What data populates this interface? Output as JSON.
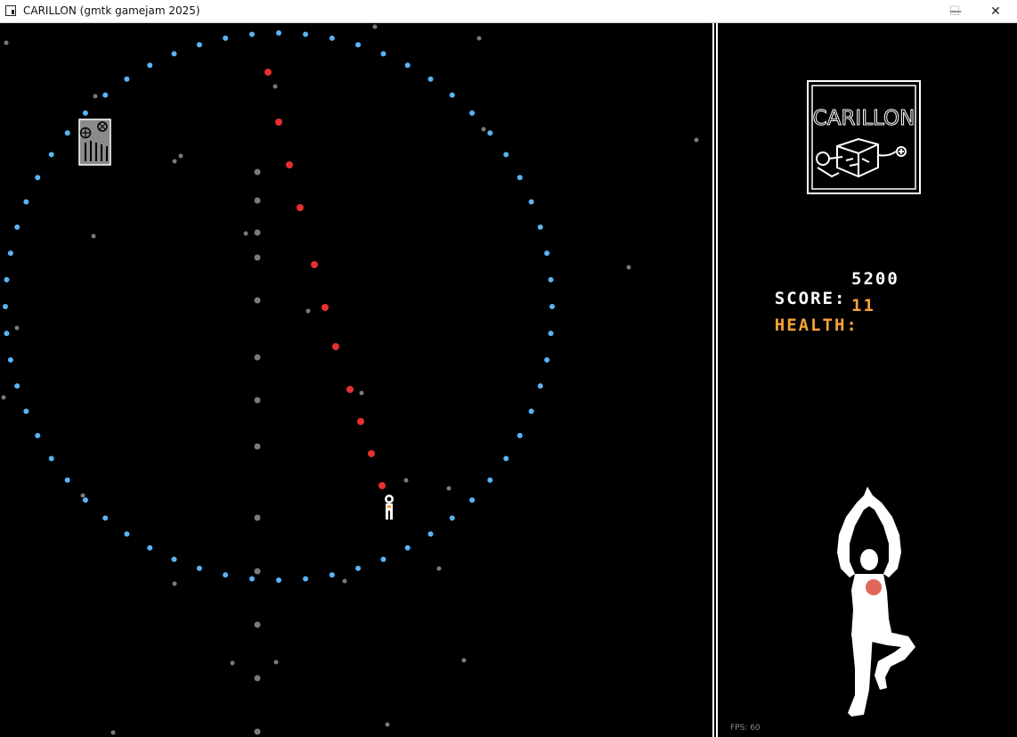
{
  "window": {
    "title": "CARILLON (gmtk gamejam 2025)",
    "minimize_glyph": "—",
    "maximize_glyph": "☐",
    "close_glyph": "✕"
  },
  "hud": {
    "score_label": "SCORE:",
    "score_value": "5200",
    "health_label": "HEALTH:",
    "health_value": "11",
    "fps": "FPS: 60",
    "logo_text": "CARILLON"
  },
  "colors": {
    "orbit_dot": "#5ab4f5",
    "path_dot": "#e53030",
    "star_dot": "#7a7a7a",
    "health": "#f7a238",
    "heart": "#e0685a"
  },
  "sprites": {
    "player": "astronaut-sprite",
    "enemy": "bell-machine-sprite",
    "dancer": "dancer-silhouette"
  }
}
